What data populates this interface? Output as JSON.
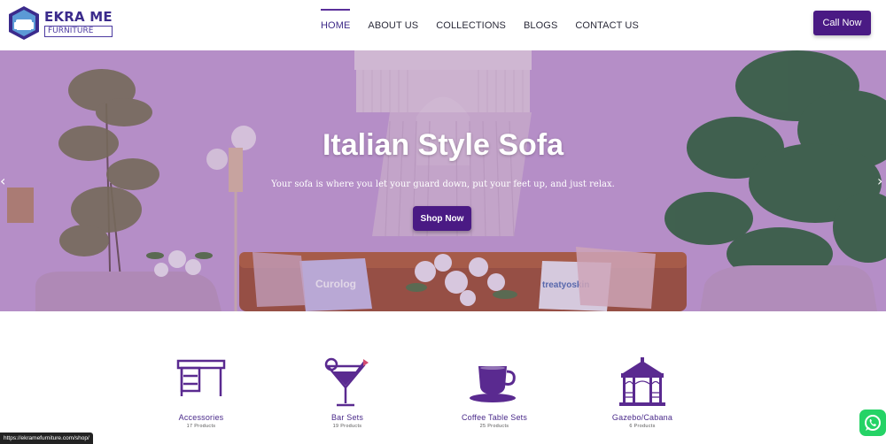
{
  "header": {
    "logo_title": "EKRA ME",
    "logo_subtitle": "FURNITURE",
    "nav": [
      {
        "label": "HOME",
        "active": true
      },
      {
        "label": "ABOUT US",
        "active": false
      },
      {
        "label": "COLLECTIONS",
        "active": false
      },
      {
        "label": "BLOGS",
        "active": false
      },
      {
        "label": "CONTACT US",
        "active": false
      }
    ],
    "call_label": "Call Now"
  },
  "hero": {
    "title": "Italian Style Sofa",
    "subtitle": "Your sofa is where you let your guard down, put your feet up, and just relax.",
    "button_label": "Shop Now",
    "prev_icon": "chevron-left-icon",
    "next_icon": "chevron-right-icon",
    "pillow_left_text": "Curolog",
    "pillow_right_text": "treatyoskin"
  },
  "categories": [
    {
      "name": "Accessories",
      "count": "17 Products",
      "icon": "desk-icon"
    },
    {
      "name": "Bar Sets",
      "count": "19 Products",
      "icon": "cocktail-glass-icon"
    },
    {
      "name": "Coffee Table Sets",
      "count": "25 Products",
      "icon": "coffee-cup-icon"
    },
    {
      "name": "Gazebo/Cabana",
      "count": "6 Products",
      "icon": "gazebo-icon"
    }
  ],
  "status_url": "https://ekramefurniture.com/shop/",
  "colors": {
    "brand_purple": "#4a1a84",
    "icon_purple": "#5a2a90",
    "whatsapp_green": "#25d366"
  }
}
